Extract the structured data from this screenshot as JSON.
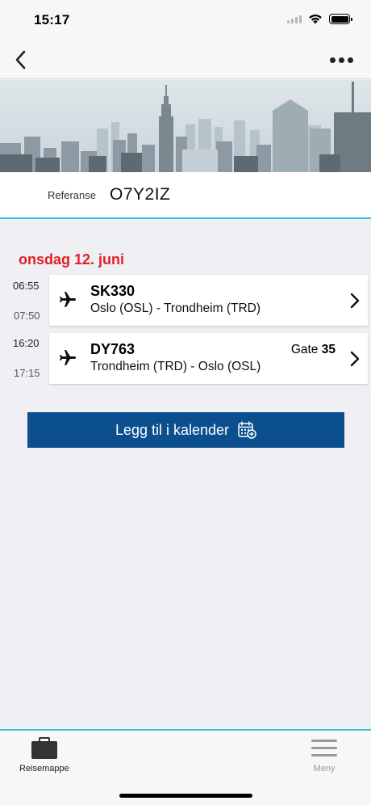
{
  "status": {
    "time": "15:17"
  },
  "booking": {
    "reference_label": "Referanse",
    "reference_value": "O7Y2IZ"
  },
  "trip": {
    "date_heading": "onsdag 12. juni",
    "flights": [
      {
        "departure": "06:55",
        "arrival": "07:50",
        "flight_number": "SK330",
        "route": "Oslo (OSL) - Trondheim (TRD)",
        "gate_label": "",
        "gate_number": ""
      },
      {
        "departure": "16:20",
        "arrival": "17:15",
        "flight_number": "DY763",
        "route": "Trondheim (TRD) - Oslo (OSL)",
        "gate_label": "Gate",
        "gate_number": "35"
      }
    ]
  },
  "actions": {
    "add_to_calendar": "Legg til i kalender"
  },
  "tabs": [
    {
      "label": "Reisemappe",
      "icon": "briefcase-icon",
      "active": true
    },
    {
      "label": "Meny",
      "icon": "hamburger-menu-icon",
      "active": false
    }
  ],
  "colors": {
    "accent_cyan": "#2fc3d3",
    "date_red": "#e31f26",
    "button_blue": "#0b4f8e"
  }
}
